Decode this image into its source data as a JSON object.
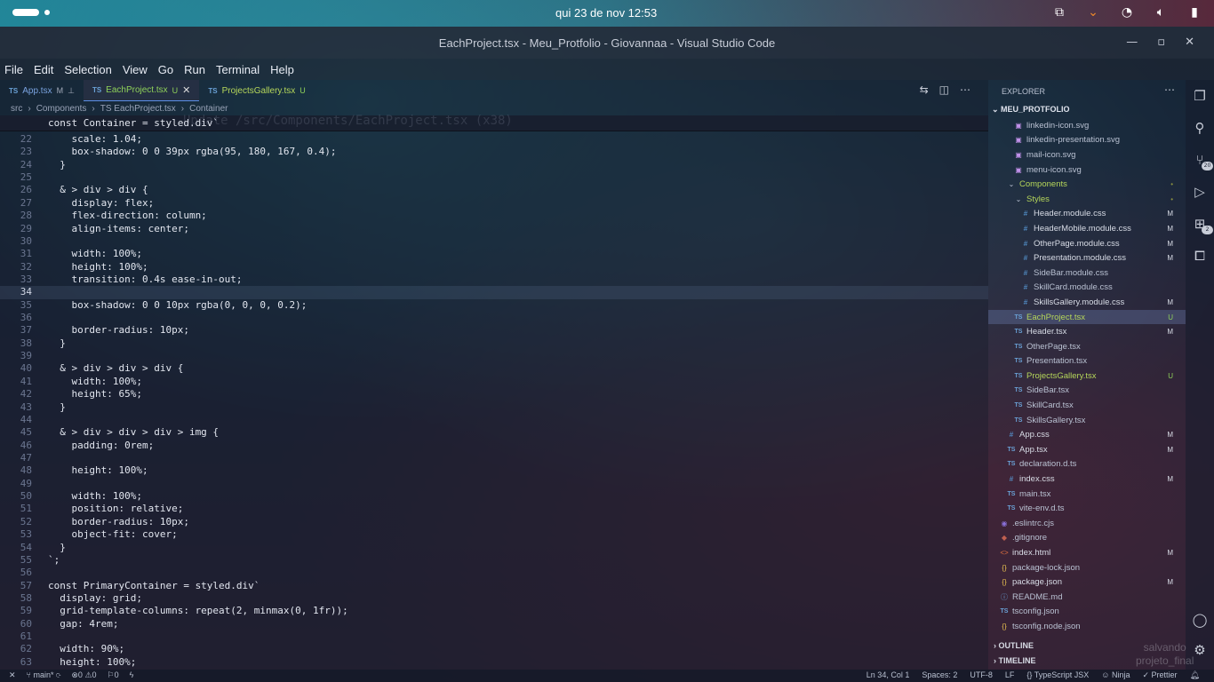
{
  "topbar": {
    "clock": "qui 23 de nov  12:53"
  },
  "window": {
    "title": "EachProject.tsx - Meu_Protfolio - Giovannaa - Visual Studio Code"
  },
  "menu": [
    "File",
    "Edit",
    "Selection",
    "View",
    "Go",
    "Run",
    "Terminal",
    "Help"
  ],
  "tabs": [
    {
      "icon": "TS",
      "label": "App.tsx",
      "status": "M"
    },
    {
      "icon": "TS",
      "label": "EachProject.tsx",
      "status": "U",
      "active": true
    },
    {
      "icon": "TS",
      "label": "ProjectsGallery.tsx",
      "status": "U"
    }
  ],
  "breadcrumb": [
    "src",
    "Components",
    "TS EachProject.tsx",
    "Container"
  ],
  "sticky": {
    "text": "const Container = styled.div`"
  },
  "ghost_text": "Update /src/Components/EachProject.tsx (x38)",
  "code": [
    {
      "n": "22",
      "t": "    scale: 1.04;"
    },
    {
      "n": "23",
      "t": "    box-shadow: 0 0 39px rgba(95, 180, 167, 0.4);"
    },
    {
      "n": "24",
      "t": "  }"
    },
    {
      "n": "25",
      "t": ""
    },
    {
      "n": "26",
      "t": "  & > div > div {"
    },
    {
      "n": "27",
      "t": "    display: flex;"
    },
    {
      "n": "28",
      "t": "    flex-direction: column;"
    },
    {
      "n": "29",
      "t": "    align-items: center;"
    },
    {
      "n": "30",
      "t": ""
    },
    {
      "n": "31",
      "t": "    width: 100%;"
    },
    {
      "n": "32",
      "t": "    height: 100%;"
    },
    {
      "n": "33",
      "t": "    transition: 0.4s ease-in-out;"
    },
    {
      "n": "34",
      "t": ""
    },
    {
      "n": "35",
      "t": "    box-shadow: 0 0 10px rgba(0, 0, 0, 0.2);"
    },
    {
      "n": "36",
      "t": ""
    },
    {
      "n": "37",
      "t": "    border-radius: 10px;"
    },
    {
      "n": "38",
      "t": "  }"
    },
    {
      "n": "39",
      "t": ""
    },
    {
      "n": "40",
      "t": "  & > div > div > div {"
    },
    {
      "n": "41",
      "t": "    width: 100%;"
    },
    {
      "n": "42",
      "t": "    height: 65%;"
    },
    {
      "n": "43",
      "t": "  }"
    },
    {
      "n": "44",
      "t": ""
    },
    {
      "n": "45",
      "t": "  & > div > div > div > img {"
    },
    {
      "n": "46",
      "t": "    padding: 0rem;"
    },
    {
      "n": "47",
      "t": ""
    },
    {
      "n": "48",
      "t": "    height: 100%;"
    },
    {
      "n": "49",
      "t": ""
    },
    {
      "n": "50",
      "t": "    width: 100%;"
    },
    {
      "n": "51",
      "t": "    position: relative;"
    },
    {
      "n": "52",
      "t": "    border-radius: 10px;"
    },
    {
      "n": "53",
      "t": "    object-fit: cover;"
    },
    {
      "n": "54",
      "t": "  }"
    },
    {
      "n": "55",
      "t": "`;"
    },
    {
      "n": "56",
      "t": ""
    },
    {
      "n": "57",
      "t": "const PrimaryContainer = styled.div`"
    },
    {
      "n": "58",
      "t": "  display: grid;"
    },
    {
      "n": "59",
      "t": "  grid-template-columns: repeat(2, minmax(0, 1fr));"
    },
    {
      "n": "60",
      "t": "  gap: 4rem;"
    },
    {
      "n": "61",
      "t": ""
    },
    {
      "n": "62",
      "t": "  width: 90%;"
    },
    {
      "n": "63",
      "t": "  height: 100%;"
    }
  ],
  "current_line": "34",
  "explorer": {
    "header": "EXPLORER",
    "root": "MEU_PROTFOLIO",
    "items": [
      {
        "label": "linkedin-icon.svg",
        "icon": "svg",
        "indent": 2,
        "status": ""
      },
      {
        "label": "linkedin-presentation.svg",
        "icon": "svg",
        "indent": 2,
        "status": ""
      },
      {
        "label": "mail-icon.svg",
        "icon": "svg",
        "indent": 2,
        "status": ""
      },
      {
        "label": "menu-icon.svg",
        "icon": "svg",
        "indent": 2,
        "status": ""
      },
      {
        "label": "Components",
        "icon": "folder-open",
        "indent": 1,
        "status": "•"
      },
      {
        "label": "Styles",
        "icon": "folder-open",
        "indent": 2,
        "status": "•"
      },
      {
        "label": "Header.module.css",
        "icon": "css",
        "indent": 3,
        "status": "M"
      },
      {
        "label": "HeaderMobile.module.css",
        "icon": "css",
        "indent": 3,
        "status": "M"
      },
      {
        "label": "OtherPage.module.css",
        "icon": "css",
        "indent": 3,
        "status": "M"
      },
      {
        "label": "Presentation.module.css",
        "icon": "css",
        "indent": 3,
        "status": "M"
      },
      {
        "label": "SideBar.module.css",
        "icon": "css",
        "indent": 3,
        "status": ""
      },
      {
        "label": "SkillCard.module.css",
        "icon": "css",
        "indent": 3,
        "status": ""
      },
      {
        "label": "SkillsGallery.module.css",
        "icon": "css",
        "indent": 3,
        "status": "M"
      },
      {
        "label": "EachProject.tsx",
        "icon": "ts",
        "indent": 2,
        "status": "U",
        "selected": true
      },
      {
        "label": "Header.tsx",
        "icon": "ts",
        "indent": 2,
        "status": "M"
      },
      {
        "label": "OtherPage.tsx",
        "icon": "ts",
        "indent": 2,
        "status": ""
      },
      {
        "label": "Presentation.tsx",
        "icon": "ts",
        "indent": 2,
        "status": ""
      },
      {
        "label": "ProjectsGallery.tsx",
        "icon": "ts",
        "indent": 2,
        "status": "U"
      },
      {
        "label": "SideBar.tsx",
        "icon": "ts",
        "indent": 2,
        "status": ""
      },
      {
        "label": "SkillCard.tsx",
        "icon": "ts",
        "indent": 2,
        "status": ""
      },
      {
        "label": "SkillsGallery.tsx",
        "icon": "ts",
        "indent": 2,
        "status": ""
      },
      {
        "label": "App.css",
        "icon": "css",
        "indent": 1,
        "status": "M"
      },
      {
        "label": "App.tsx",
        "icon": "ts",
        "indent": 1,
        "status": "M"
      },
      {
        "label": "declaration.d.ts",
        "icon": "ts",
        "indent": 1,
        "status": ""
      },
      {
        "label": "index.css",
        "icon": "css",
        "indent": 1,
        "status": "M"
      },
      {
        "label": "main.tsx",
        "icon": "ts",
        "indent": 1,
        "status": ""
      },
      {
        "label": "vite-env.d.ts",
        "icon": "ts",
        "indent": 1,
        "status": ""
      },
      {
        "label": ".eslintrc.cjs",
        "icon": "eslint",
        "indent": 0,
        "status": ""
      },
      {
        "label": ".gitignore",
        "icon": "git",
        "indent": 0,
        "status": ""
      },
      {
        "label": "index.html",
        "icon": "html",
        "indent": 0,
        "status": "M"
      },
      {
        "label": "package-lock.json",
        "icon": "json",
        "indent": 0,
        "status": ""
      },
      {
        "label": "package.json",
        "icon": "json",
        "indent": 0,
        "status": "M"
      },
      {
        "label": "README.md",
        "icon": "md",
        "indent": 0,
        "status": ""
      },
      {
        "label": "tsconfig.json",
        "icon": "ts",
        "indent": 0,
        "status": ""
      },
      {
        "label": "tsconfig.node.json",
        "icon": "json",
        "indent": 0,
        "status": ""
      }
    ],
    "outline": "OUTLINE",
    "timeline": "TIMELINE"
  },
  "activity_badges": {
    "scm": "20",
    "extensions": "2"
  },
  "status": {
    "branch": "main*",
    "errors": "0",
    "warnings": "0",
    "ports": "0",
    "position": "Ln 34, Col 1",
    "spaces": "Spaces: 2",
    "encoding": "UTF-8",
    "eol": "LF",
    "language": "TypeScript JSX",
    "extra1": "Ninja",
    "prettier": "Prettier"
  },
  "overlay": {
    "line1": "salvando",
    "line2": "projeto_final"
  }
}
